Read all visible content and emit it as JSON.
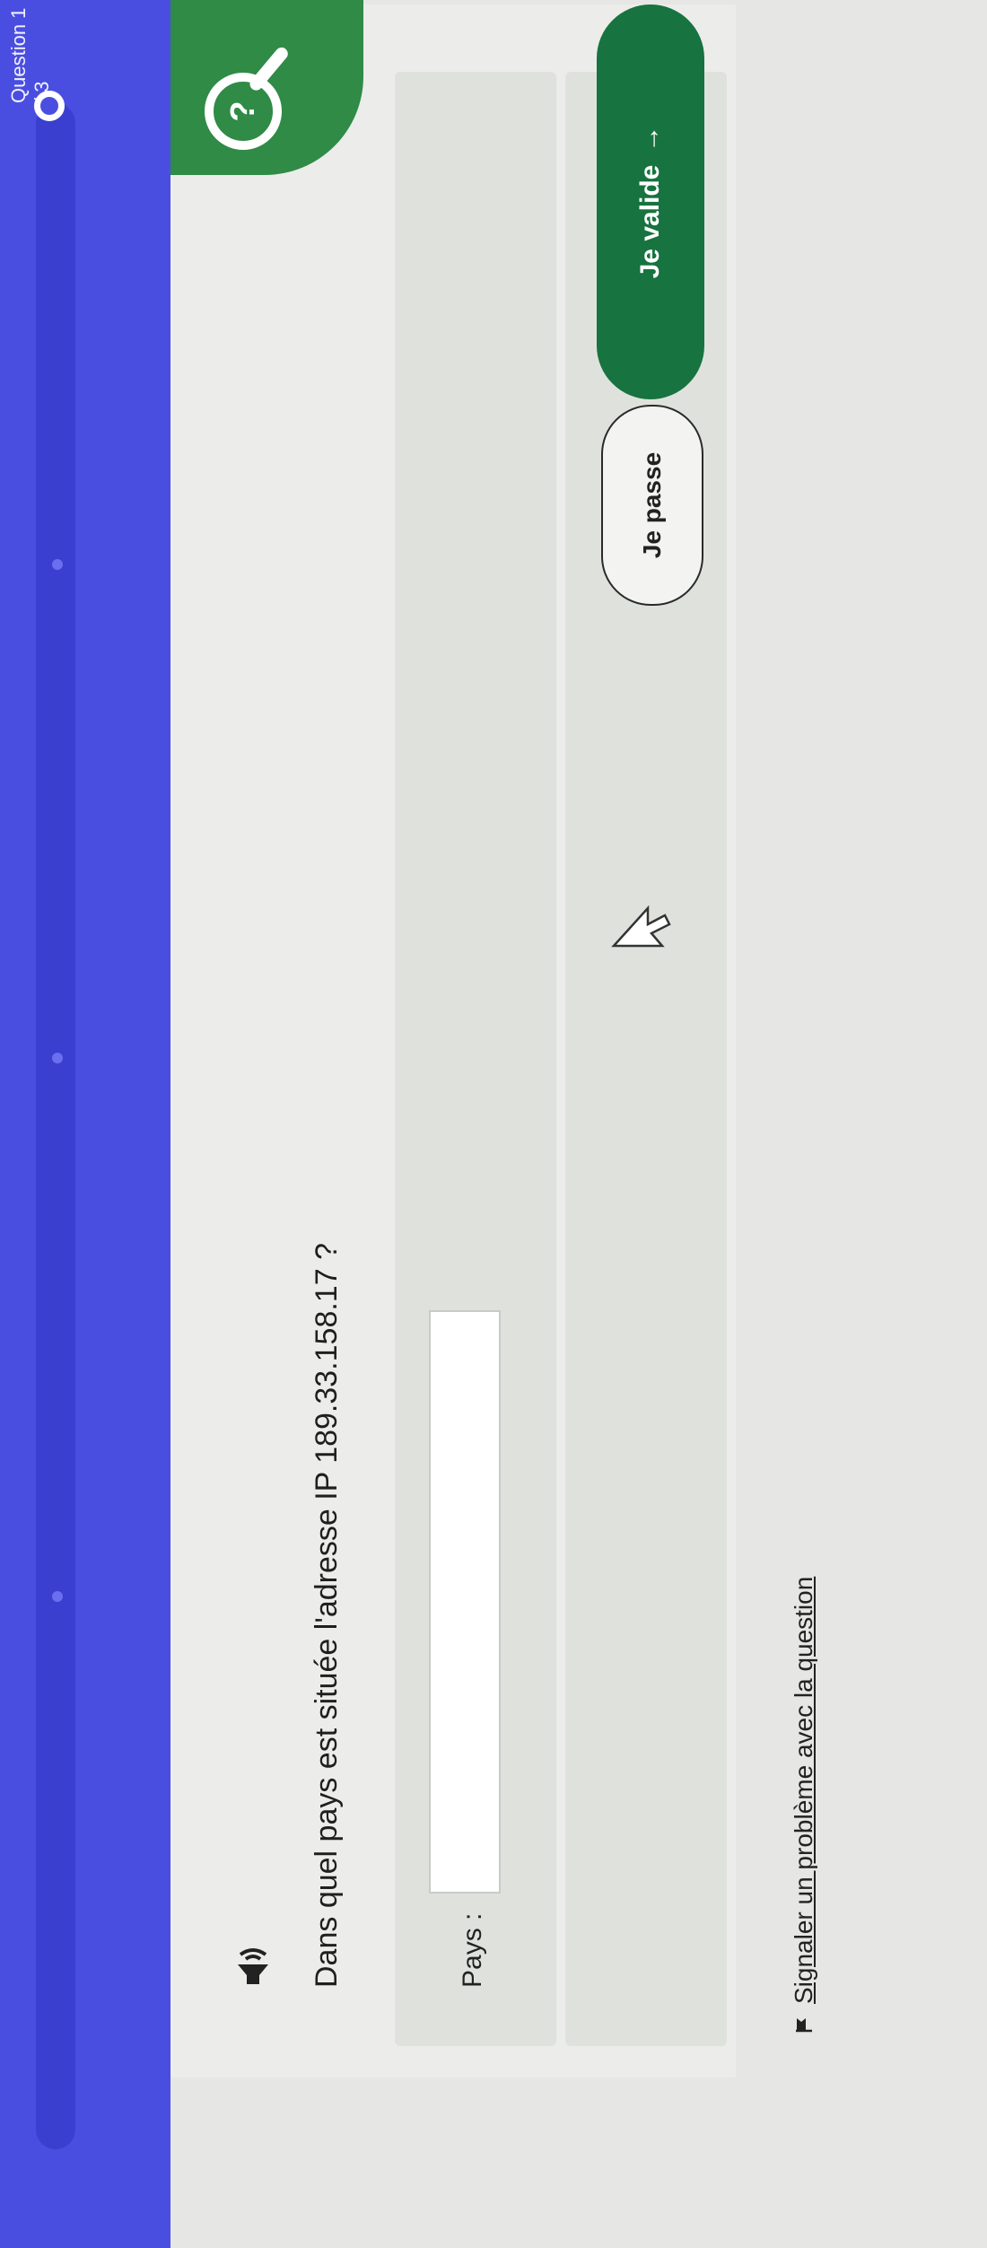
{
  "header": {
    "question_counter": "Question 1 / 3"
  },
  "help": {
    "icon": "help-magnifier-icon",
    "glyph": "?"
  },
  "question": {
    "speaker_icon": "speaker-icon",
    "text": "Dans quel pays est située l'adresse IP 189.33.158.17 ?"
  },
  "answer": {
    "label": "Pays :",
    "value": "",
    "placeholder": ""
  },
  "actions": {
    "skip_label": "Je passe",
    "validate_label": "Je valide",
    "validate_arrow": "→"
  },
  "footer": {
    "flag_icon": "flag-icon",
    "report_link": "Signaler un problème avec la question"
  },
  "colors": {
    "header_bg": "#4a4ee0",
    "accent_green": "#17733f",
    "help_green": "#2f8b46"
  }
}
